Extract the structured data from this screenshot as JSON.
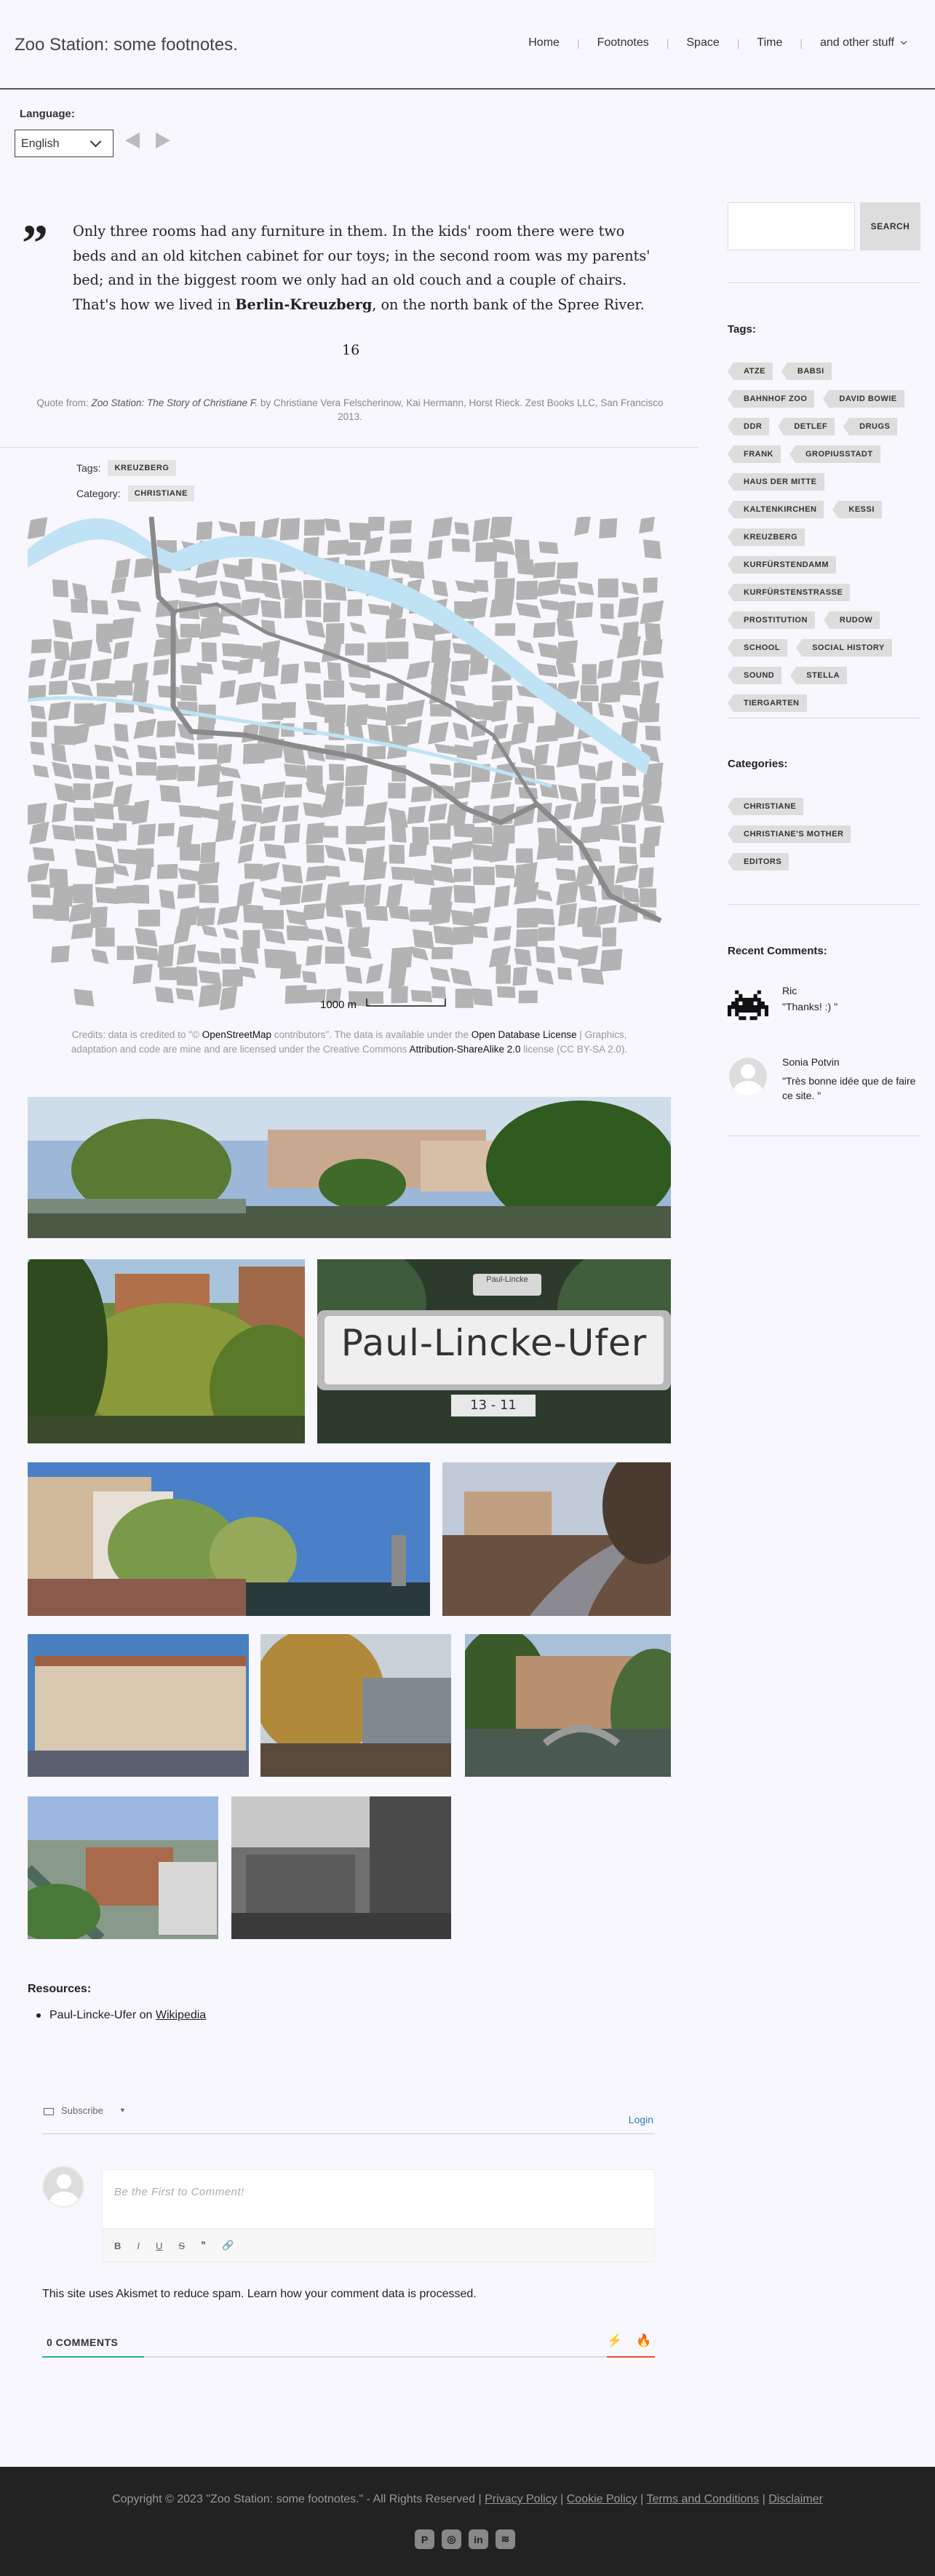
{
  "site": {
    "title": "Zoo Station: some footnotes."
  },
  "nav": {
    "items": [
      "Home",
      "Footnotes",
      "Space",
      "Time",
      "and other stuff"
    ],
    "dropdown_icon": "chevron-down-icon"
  },
  "language": {
    "label": "Language:",
    "selected": "English"
  },
  "quote": {
    "text_before": "Only three rooms had any furniture in them. In the kids' room there were two beds and an old kitchen cabinet for our toys; in the second room was my parents' bed; and in the biggest room we only had an old couch and a couple of chairs. That's how we lived in ",
    "bold": "Berlin-Kreuzberg",
    "text_after": ", on the north bank of the Spree River.",
    "page": "16",
    "source_prefix": "Quote from:",
    "source_title": "Zoo Station: The Story of Christiane F.",
    "source_rest": "by Christiane Vera Felscherinow, Kai Hermann, Horst Rieck. Zest Books LLC, San Francisco 2013."
  },
  "post_meta": {
    "tags_label": "Tags:",
    "tag": "KREUZBERG",
    "category_label": "Category:",
    "category": "CHRISTIANE"
  },
  "map": {
    "scale_label": "1000 m",
    "water_color": "#bfe3f5",
    "block_color": "#b3b3b3"
  },
  "credits": {
    "p1": "Credits: data is credited to \"© ",
    "osm": "OpenStreetMap",
    "p2": " contributors\". The data is available under the ",
    "odl": "Open Database License",
    "p3": " | Graphics, adaptation and code are mine and are licensed under the Creative Commons ",
    "cc": "Attribution-ShareAlike 2.0",
    "p4": " license (CC BY-SA 2.0)."
  },
  "sign": {
    "street": "Paul-Lincke-Ufer",
    "top": "Paul-Lincke",
    "number": "13 - 11"
  },
  "resources": {
    "title": "Resources:",
    "item_text": "Paul-Lincke-Ufer on ",
    "item_link": "Wikipedia"
  },
  "comments": {
    "subscribe": "Subscribe",
    "login": "Login",
    "placeholder": "Be the First to Comment!",
    "akismet": "This site uses Akismet to reduce spam. Learn how your comment data is processed.",
    "count": "0 COMMENTS",
    "toolbar": [
      "B",
      "I",
      "U",
      "S",
      "❞",
      "🔗"
    ]
  },
  "sidebar": {
    "search_button": "SEARCH",
    "tags_title": "Tags:",
    "tags": [
      "ATZE",
      "BABSI",
      "BAHNHOF ZOO",
      "DAVID BOWIE",
      "DDR",
      "DETLEF",
      "DRUGS",
      "FRANK",
      "GROPIUSSTADT",
      "HAUS DER MITTE",
      "KALTENKIRCHEN",
      "KESSI",
      "KREUZBERG",
      "KURFÜRSTENDAMM",
      "KURFÜRSTENSTRASSE",
      "PROSTITUTION",
      "RUDOW",
      "SCHOOL",
      "SOCIAL HISTORY",
      "SOUND",
      "STELLA",
      "TIERGARTEN"
    ],
    "categories_title": "Categories:",
    "categories": [
      "CHRISTIANE",
      "CHRISTIANE'S MOTHER",
      "EDITORS"
    ],
    "recent_title": "Recent Comments:",
    "recent": [
      {
        "author": "Ric",
        "text": "\"Thanks! :) \""
      },
      {
        "author": "Sonia Potvin",
        "text": "\"Très bonne idée que de faire ce site. \""
      }
    ]
  },
  "footer": {
    "copyright": "Copyright © 2023 \"Zoo Station: some footnotes.\" - All Rights Reserved |",
    "links": [
      "Privacy Policy",
      "Cookie Policy",
      "Terms and Conditions",
      "Disclaimer"
    ],
    "social_icons": [
      "pinterest-icon",
      "instagram-icon",
      "linkedin-icon",
      "rss-icon"
    ]
  }
}
